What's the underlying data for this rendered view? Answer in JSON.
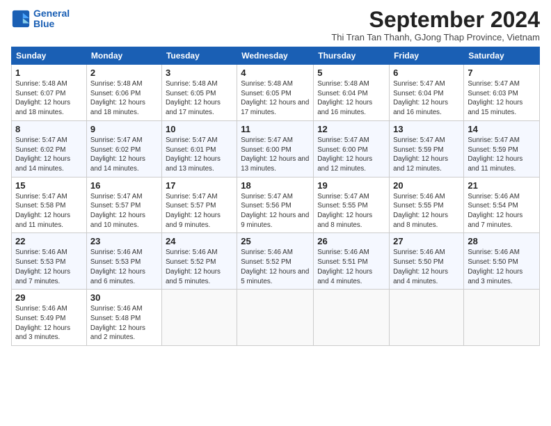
{
  "header": {
    "logo_line1": "General",
    "logo_line2": "Blue",
    "month_title": "September 2024",
    "subtitle": "Thi Tran Tan Thanh, GJong Thap Province, Vietnam"
  },
  "days_of_week": [
    "Sunday",
    "Monday",
    "Tuesday",
    "Wednesday",
    "Thursday",
    "Friday",
    "Saturday"
  ],
  "weeks": [
    [
      {
        "day": "1",
        "info": "Sunrise: 5:48 AM\nSunset: 6:07 PM\nDaylight: 12 hours and 18 minutes."
      },
      {
        "day": "2",
        "info": "Sunrise: 5:48 AM\nSunset: 6:06 PM\nDaylight: 12 hours and 18 minutes."
      },
      {
        "day": "3",
        "info": "Sunrise: 5:48 AM\nSunset: 6:05 PM\nDaylight: 12 hours and 17 minutes."
      },
      {
        "day": "4",
        "info": "Sunrise: 5:48 AM\nSunset: 6:05 PM\nDaylight: 12 hours and 17 minutes."
      },
      {
        "day": "5",
        "info": "Sunrise: 5:48 AM\nSunset: 6:04 PM\nDaylight: 12 hours and 16 minutes."
      },
      {
        "day": "6",
        "info": "Sunrise: 5:47 AM\nSunset: 6:04 PM\nDaylight: 12 hours and 16 minutes."
      },
      {
        "day": "7",
        "info": "Sunrise: 5:47 AM\nSunset: 6:03 PM\nDaylight: 12 hours and 15 minutes."
      }
    ],
    [
      {
        "day": "8",
        "info": "Sunrise: 5:47 AM\nSunset: 6:02 PM\nDaylight: 12 hours and 14 minutes."
      },
      {
        "day": "9",
        "info": "Sunrise: 5:47 AM\nSunset: 6:02 PM\nDaylight: 12 hours and 14 minutes."
      },
      {
        "day": "10",
        "info": "Sunrise: 5:47 AM\nSunset: 6:01 PM\nDaylight: 12 hours and 13 minutes."
      },
      {
        "day": "11",
        "info": "Sunrise: 5:47 AM\nSunset: 6:00 PM\nDaylight: 12 hours and 13 minutes."
      },
      {
        "day": "12",
        "info": "Sunrise: 5:47 AM\nSunset: 6:00 PM\nDaylight: 12 hours and 12 minutes."
      },
      {
        "day": "13",
        "info": "Sunrise: 5:47 AM\nSunset: 5:59 PM\nDaylight: 12 hours and 12 minutes."
      },
      {
        "day": "14",
        "info": "Sunrise: 5:47 AM\nSunset: 5:59 PM\nDaylight: 12 hours and 11 minutes."
      }
    ],
    [
      {
        "day": "15",
        "info": "Sunrise: 5:47 AM\nSunset: 5:58 PM\nDaylight: 12 hours and 11 minutes."
      },
      {
        "day": "16",
        "info": "Sunrise: 5:47 AM\nSunset: 5:57 PM\nDaylight: 12 hours and 10 minutes."
      },
      {
        "day": "17",
        "info": "Sunrise: 5:47 AM\nSunset: 5:57 PM\nDaylight: 12 hours and 9 minutes."
      },
      {
        "day": "18",
        "info": "Sunrise: 5:47 AM\nSunset: 5:56 PM\nDaylight: 12 hours and 9 minutes."
      },
      {
        "day": "19",
        "info": "Sunrise: 5:47 AM\nSunset: 5:55 PM\nDaylight: 12 hours and 8 minutes."
      },
      {
        "day": "20",
        "info": "Sunrise: 5:46 AM\nSunset: 5:55 PM\nDaylight: 12 hours and 8 minutes."
      },
      {
        "day": "21",
        "info": "Sunrise: 5:46 AM\nSunset: 5:54 PM\nDaylight: 12 hours and 7 minutes."
      }
    ],
    [
      {
        "day": "22",
        "info": "Sunrise: 5:46 AM\nSunset: 5:53 PM\nDaylight: 12 hours and 7 minutes."
      },
      {
        "day": "23",
        "info": "Sunrise: 5:46 AM\nSunset: 5:53 PM\nDaylight: 12 hours and 6 minutes."
      },
      {
        "day": "24",
        "info": "Sunrise: 5:46 AM\nSunset: 5:52 PM\nDaylight: 12 hours and 5 minutes."
      },
      {
        "day": "25",
        "info": "Sunrise: 5:46 AM\nSunset: 5:52 PM\nDaylight: 12 hours and 5 minutes."
      },
      {
        "day": "26",
        "info": "Sunrise: 5:46 AM\nSunset: 5:51 PM\nDaylight: 12 hours and 4 minutes."
      },
      {
        "day": "27",
        "info": "Sunrise: 5:46 AM\nSunset: 5:50 PM\nDaylight: 12 hours and 4 minutes."
      },
      {
        "day": "28",
        "info": "Sunrise: 5:46 AM\nSunset: 5:50 PM\nDaylight: 12 hours and 3 minutes."
      }
    ],
    [
      {
        "day": "29",
        "info": "Sunrise: 5:46 AM\nSunset: 5:49 PM\nDaylight: 12 hours and 3 minutes."
      },
      {
        "day": "30",
        "info": "Sunrise: 5:46 AM\nSunset: 5:48 PM\nDaylight: 12 hours and 2 minutes."
      },
      {
        "day": "",
        "info": ""
      },
      {
        "day": "",
        "info": ""
      },
      {
        "day": "",
        "info": ""
      },
      {
        "day": "",
        "info": ""
      },
      {
        "day": "",
        "info": ""
      }
    ]
  ]
}
